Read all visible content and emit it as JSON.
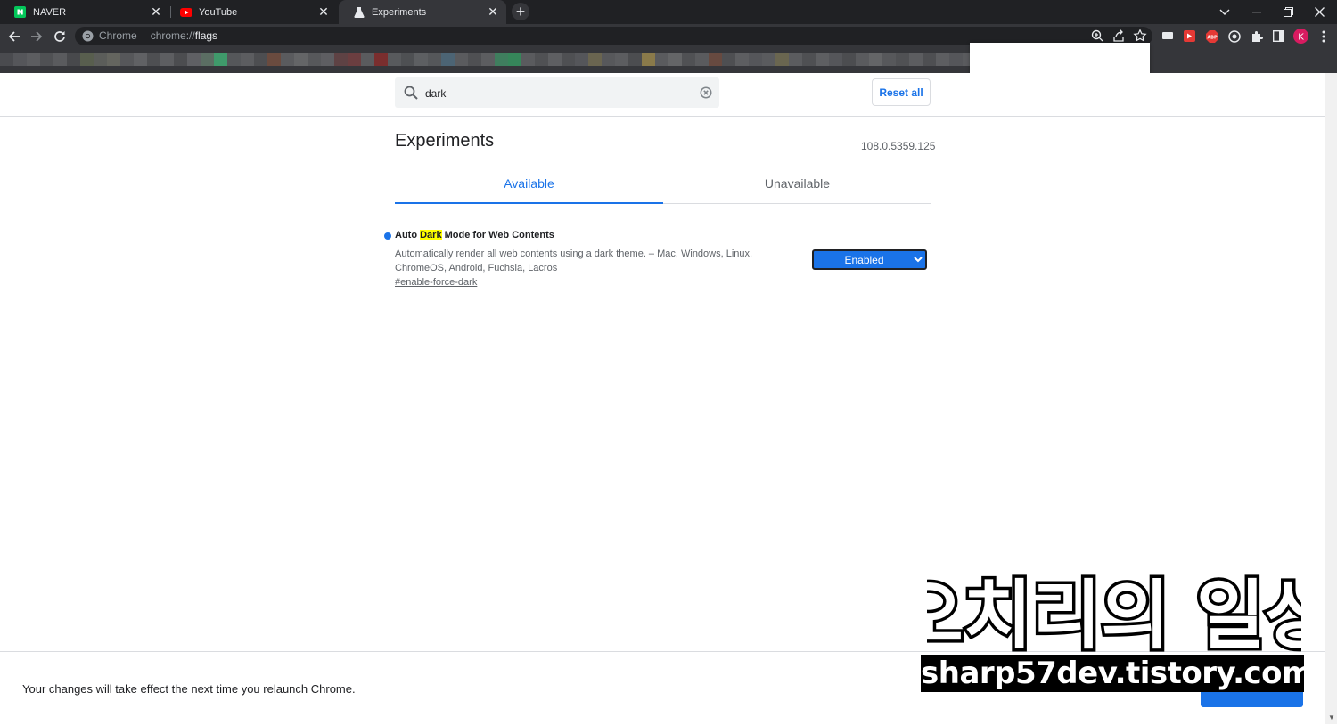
{
  "browser": {
    "tabs": [
      {
        "label": "NAVER",
        "active": false
      },
      {
        "label": "YouTube",
        "active": false
      },
      {
        "label": "Experiments",
        "active": true
      }
    ],
    "omnibox": {
      "site_label": "Chrome",
      "url_scheme": "chrome://",
      "url_host": "flags"
    },
    "profile_initial": "K"
  },
  "page": {
    "search": {
      "value": "dark"
    },
    "reset_label": "Reset all",
    "title": "Experiments",
    "version": "108.0.5359.125",
    "tabs": [
      {
        "label": "Available"
      },
      {
        "label": "Unavailable"
      }
    ],
    "experiment": {
      "name_before": "Auto ",
      "name_highlight": "Dark",
      "name_after": " Mode for Web Contents",
      "description": "Automatically render all web contents using a dark theme. – Mac, Windows, Linux, ChromeOS, Android, Fuchsia, Lacros",
      "link": "#enable-force-dark",
      "selected": "Enabled"
    },
    "relaunch_message": "Your changes will take effect the next time you relaunch Chrome."
  },
  "watermark": {
    "title": "오치리의 일상",
    "url": "sharp57dev.tistory.com"
  },
  "colors": {
    "accent": "#1a73e8",
    "highlight": "#ffff00",
    "tab_strip": "#202124",
    "toolbar": "#35363a"
  }
}
